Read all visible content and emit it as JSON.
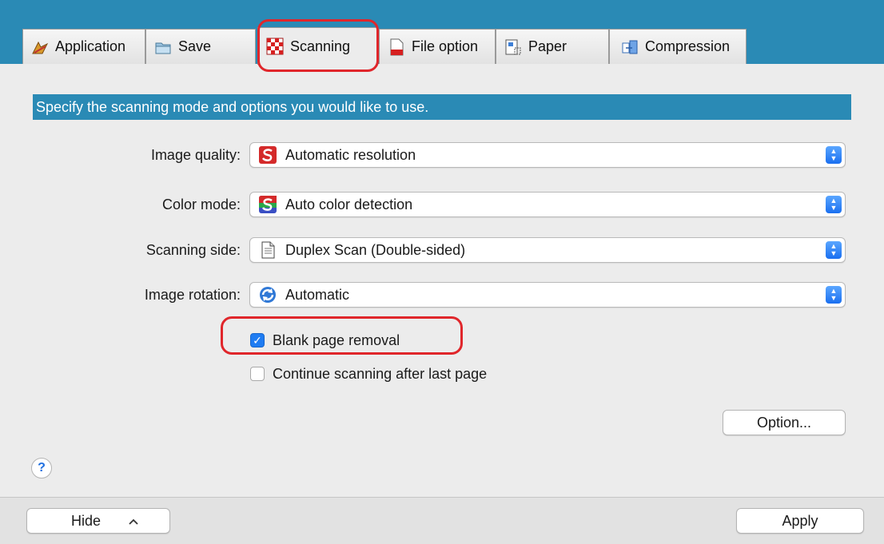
{
  "tabs": [
    {
      "label": "Application",
      "icon": "application-icon"
    },
    {
      "label": "Save",
      "icon": "folder-icon"
    },
    {
      "label": "Scanning",
      "icon": "scanning-icon"
    },
    {
      "label": "File option",
      "icon": "pdf-file-icon"
    },
    {
      "label": "Paper",
      "icon": "paper-icon"
    },
    {
      "label": "Compression",
      "icon": "compression-icon"
    }
  ],
  "active_tab": "Scanning",
  "banner": "Specify the scanning mode and options you would like to use.",
  "settings": {
    "image_quality": {
      "label": "Image quality:",
      "value": "Automatic resolution"
    },
    "color_mode": {
      "label": "Color mode:",
      "value": "Auto color detection"
    },
    "scanning_side": {
      "label": "Scanning side:",
      "value": "Duplex Scan (Double-sided)"
    },
    "image_rotation": {
      "label": "Image rotation:",
      "value": "Automatic"
    }
  },
  "checkboxes": {
    "blank_page_removal": {
      "label": "Blank page removal",
      "checked": true
    },
    "continue_scanning": {
      "label": "Continue scanning after last page",
      "checked": false
    }
  },
  "buttons": {
    "option": "Option...",
    "help": "?",
    "hide": "Hide",
    "apply": "Apply"
  },
  "colors": {
    "accent": "#2a8ab5",
    "highlight": "#e0262b",
    "checkbox_on": "#1f7cf2"
  }
}
